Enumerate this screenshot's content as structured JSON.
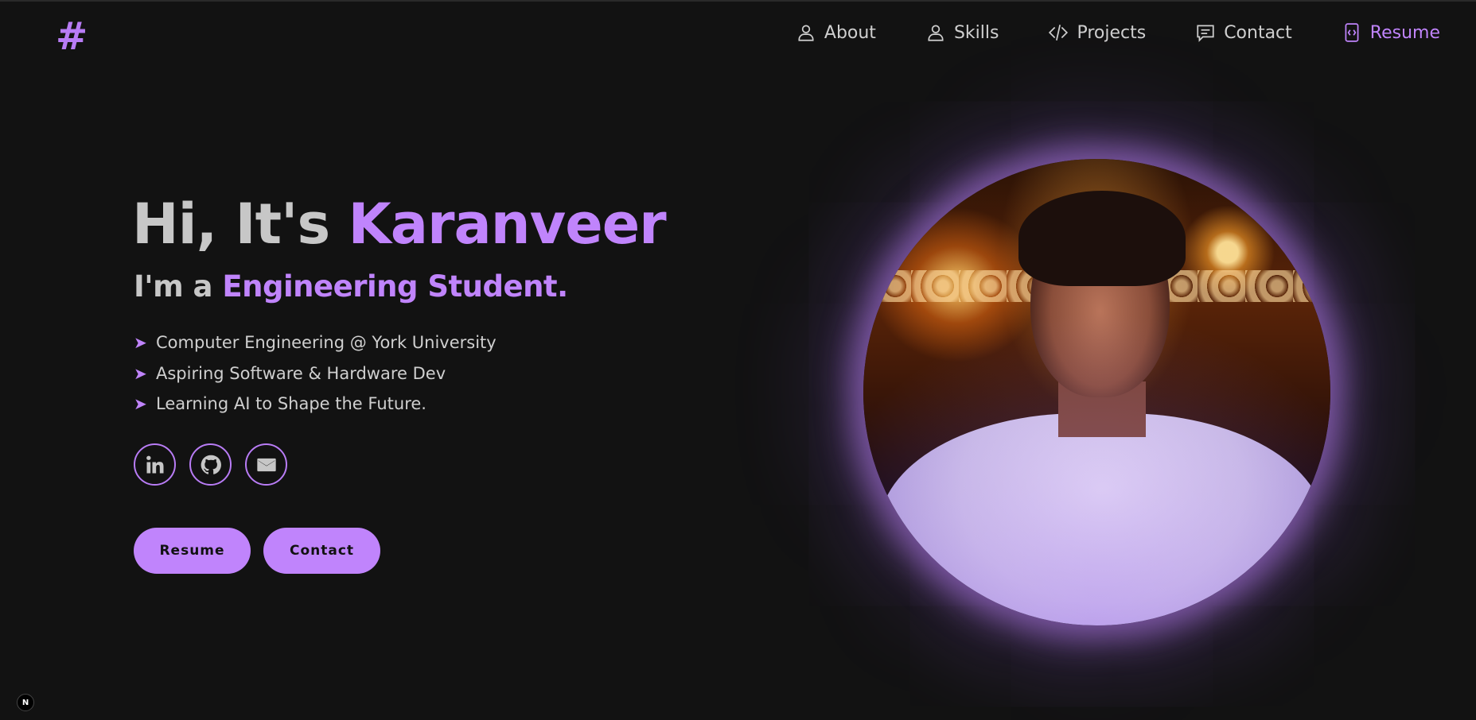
{
  "logo": {
    "symbol": "#"
  },
  "nav": {
    "items": [
      {
        "label": "About",
        "icon": "user-icon"
      },
      {
        "label": "Skills",
        "icon": "user-icon"
      },
      {
        "label": "Projects",
        "icon": "code-icon"
      },
      {
        "label": "Contact",
        "icon": "message-icon"
      },
      {
        "label": "Resume",
        "icon": "file-code-icon"
      }
    ],
    "active": "Resume"
  },
  "hero": {
    "greeting": "Hi, It's",
    "name": "Karanveer",
    "sub_prefix": "I'm a",
    "sub_highlight": "Engineering Student.",
    "bullets": [
      "Computer Engineering @ York University",
      "Aspiring Software & Hardware Dev",
      "Learning AI to Shape the Future."
    ],
    "bullet_marker": "➤"
  },
  "socials": [
    {
      "icon": "linkedin-icon"
    },
    {
      "icon": "github-icon"
    },
    {
      "icon": "mail-icon"
    }
  ],
  "ctas": {
    "resume": "Resume",
    "contact": "Contact"
  },
  "badge": {
    "label": "N"
  },
  "colors": {
    "background": "#121212",
    "accent": "#c084fc",
    "text": "#cfcfcf"
  }
}
